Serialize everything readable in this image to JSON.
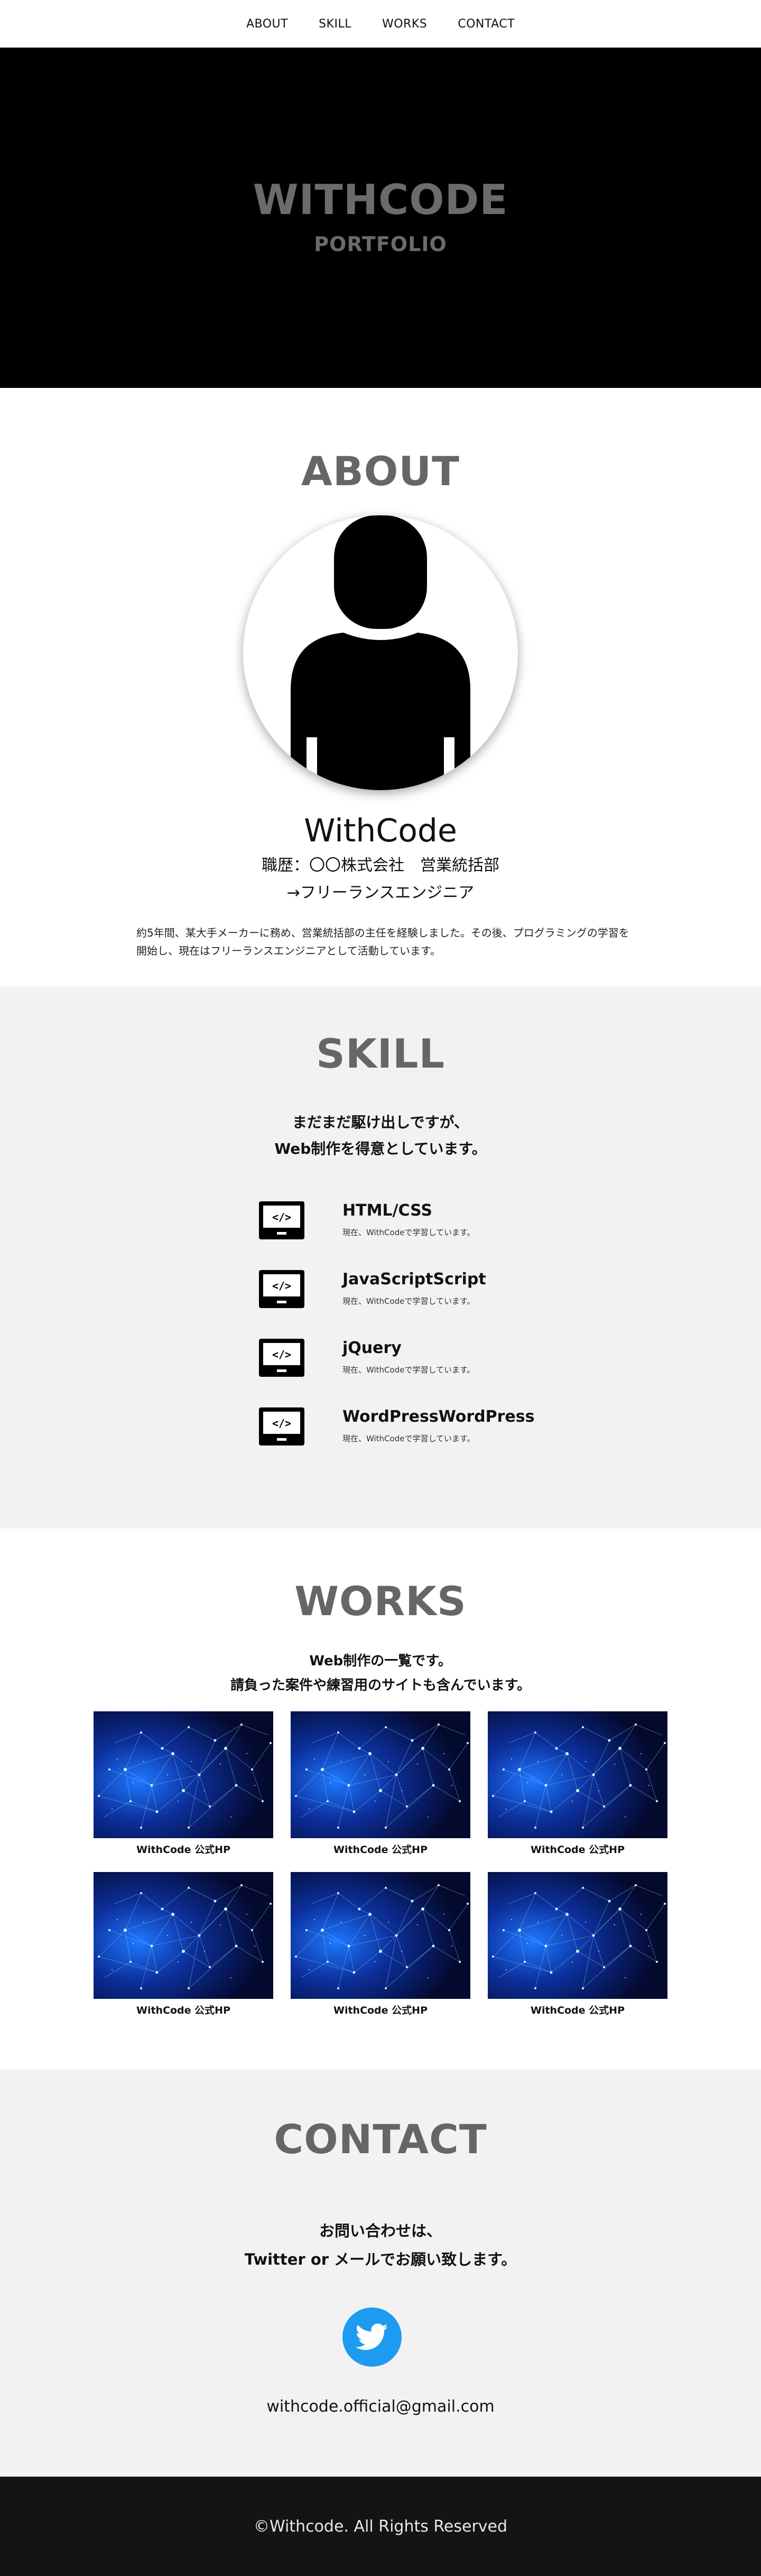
{
  "nav": {
    "items": [
      "ABOUT",
      "SKILL",
      "WORKS",
      "CONTACT"
    ]
  },
  "hero": {
    "title": "WITHCODE",
    "subtitle": "PORTFOLIO"
  },
  "about": {
    "heading": "ABOUT",
    "name": "WithCode",
    "career_line1": "職歴：〇〇株式会社　営業統括部",
    "career_line2": "→フリーランスエンジニア",
    "description": "約5年間、某大手メーカーに務め、営業統括部の主任を経験しました。その後、プログラミングの学習を開始し、現在はフリーランスエンジニアとして活動しています。"
  },
  "skill": {
    "heading": "SKILL",
    "lead_line1": "まだまだ駆け出しですが、",
    "lead_line2": "Web制作を得意としています。",
    "items": [
      {
        "name": "HTML/CSS",
        "text": "現在、WithCodeで学習しています。"
      },
      {
        "name": "JavaScriptScript",
        "text": "現在、WithCodeで学習しています。"
      },
      {
        "name": "jQuery",
        "text": "現在、WithCodeで学習しています。"
      },
      {
        "name": "WordPressWordPress",
        "text": "現在、WithCodeで学習しています。"
      }
    ],
    "icon": "code-monitor-icon"
  },
  "works": {
    "heading": "WORKS",
    "lead_line1": "Web制作の一覧です。",
    "lead_line2": "請負った案件や練習用のサイトも含んでいます。",
    "items": [
      {
        "caption": "WithCode 公式HP"
      },
      {
        "caption": "WithCode 公式HP"
      },
      {
        "caption": "WithCode 公式HP"
      },
      {
        "caption": "WithCode 公式HP"
      },
      {
        "caption": "WithCode 公式HP"
      },
      {
        "caption": "WithCode 公式HP"
      }
    ]
  },
  "contact": {
    "heading": "CONTACT",
    "lead_line1": "お問い合わせは、",
    "lead_line2": "Twitter or メールでお願い致します。",
    "email": "withcode.official@gmail.com",
    "twitter_color": "#1d9bf0"
  },
  "footer": {
    "text": "©Withcode. All Rights Reserved"
  }
}
